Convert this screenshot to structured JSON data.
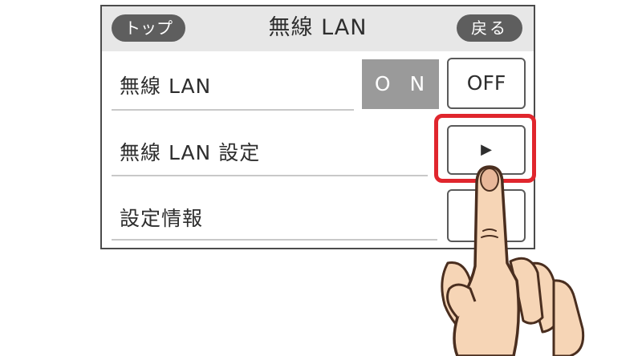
{
  "header": {
    "top_button": "トップ",
    "title": "無線 LAN",
    "back_button": "戻る"
  },
  "rows": [
    {
      "label": "無線 LAN",
      "on_label": "O N",
      "off_label": "OFF"
    },
    {
      "label": "無線 LAN 設定",
      "button_symbol": "▶"
    },
    {
      "label": "設定情報"
    }
  ],
  "colors": {
    "header_bg": "#e7e7e7",
    "pill_bg": "#5e5e5e",
    "on_bg": "#9a9a9a",
    "highlight": "#e0262d",
    "skin": "#f6d5b6"
  }
}
